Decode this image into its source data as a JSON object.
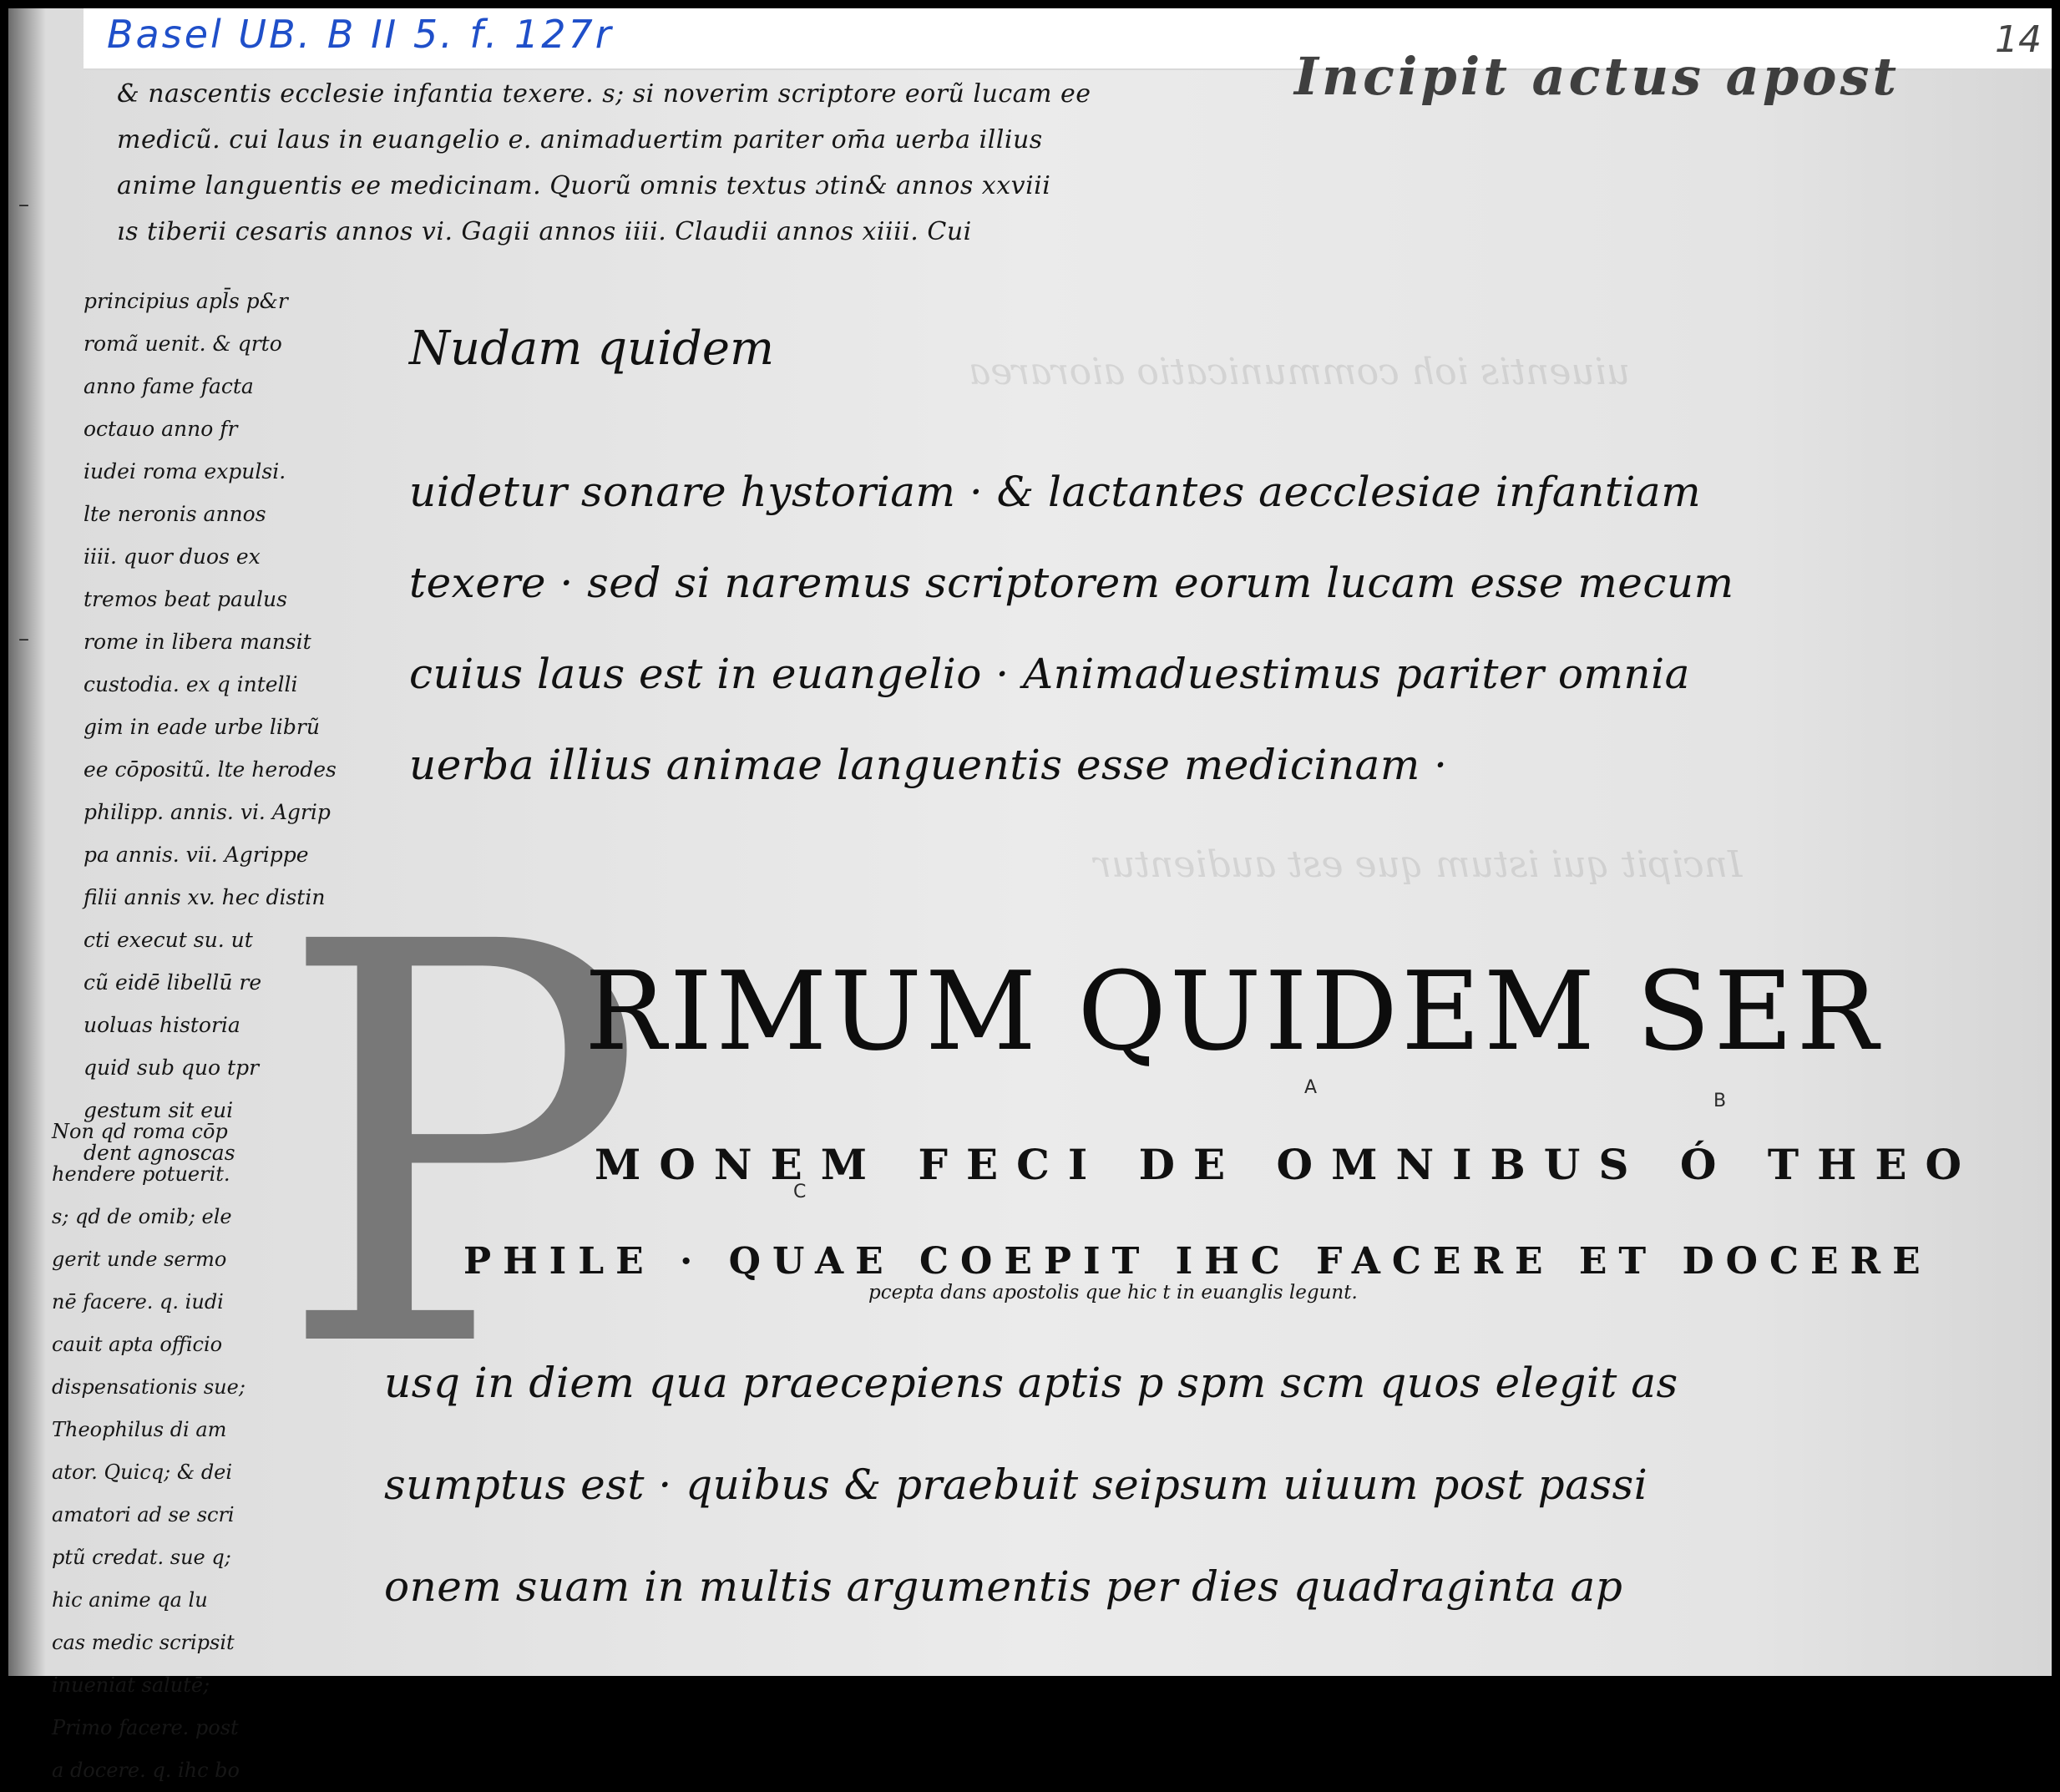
{
  "label": {
    "archive_reference": "Basel UB. B II 5. f. 127r",
    "folio_number": "14"
  },
  "heading_fragment": "Incipit actus apost",
  "prologue_lines": [
    "& nascentis ecclesie infantia texere. s; si noverim scriptore eorũ lucam ee",
    "medicũ. cui laus in euangelio e. animaduertim pariter om̄a uerba illius",
    "anime languentis ee medicinam. Quorũ omnis textus ɔtin& annos xxviii",
    "ıs tiberii cesaris annos vi. Gagii annos iiii. Claudii annos xiiii. Cui"
  ],
  "gloss_lines": [
    "principius apl̄s p&r",
    "romã uenit. & qrto",
    "anno fame facta",
    "octauo anno fr",
    "iudei roma expulsi.",
    "lte neronis annos",
    "iiii. quor duos ex",
    "tremos beat paulus",
    "rome in libera mansit",
    "custodia. ex q intelli",
    "gim in eade urbe librũ",
    "ee cōpositũ. lte herodes",
    "philipp. annis. vi. Agrip",
    "pa annis. vii. Agrippe",
    "filii annis xv. hec distin",
    "cti execut su. ut",
    "cũ eidē libellū re",
    "uoluas historia",
    "quid sub quo tpr",
    "gestum sit eui",
    "dent agnoscas"
  ],
  "gloss_lower_lines": [
    "Non qd roma cōp",
    "hendere potuerit.",
    "s; qd de omib; ele",
    "gerit unde sermo",
    "nē facere. q. iudi",
    "cauit apta officio",
    "dispensationis sue;",
    "Theophilus di am",
    "ator. Quicq; & dei",
    "amatori ad se scri",
    "ptũ credat. sue q;",
    "hic anime qa lu",
    "cas medic scripsit",
    "inueniat salutē;",
    "Primo facere. post",
    "a docere. q. ihc bo"
  ],
  "incipit": "Nudam quidem",
  "main_lines": [
    "uidetur sonare hystoriam · & lactantes aecclesiae infantiam",
    "texere · sed si naremus scriptorem eorum lucam esse mecum",
    "cuius laus est in euangelio · Animaduestimus pariter omnia",
    "uerba illius animae languentis esse medicinam ·"
  ],
  "initial_letter": "P",
  "capitals_line": "RIMUM QUIDEM SER",
  "uncial_line_1": "MONEM FECI DE OMNIBUS Ó THEO",
  "uncial_line_2": "PHILE · QUAE COEPIT IHC FACERE ET DOCERE",
  "interlinear_gloss": "pcepta dans apostolis que hic t in euanglis legunt.",
  "markers": {
    "a": "A",
    "b": "B",
    "c": "C"
  },
  "lower_lines": [
    "usq in diem qua praecepiens aptis p spm scm quos elegit as",
    "sumptus est · quibus & praebuit seipsum uiuum post passi",
    "onem suam in multis argumentis per dies quadraginta ap"
  ]
}
